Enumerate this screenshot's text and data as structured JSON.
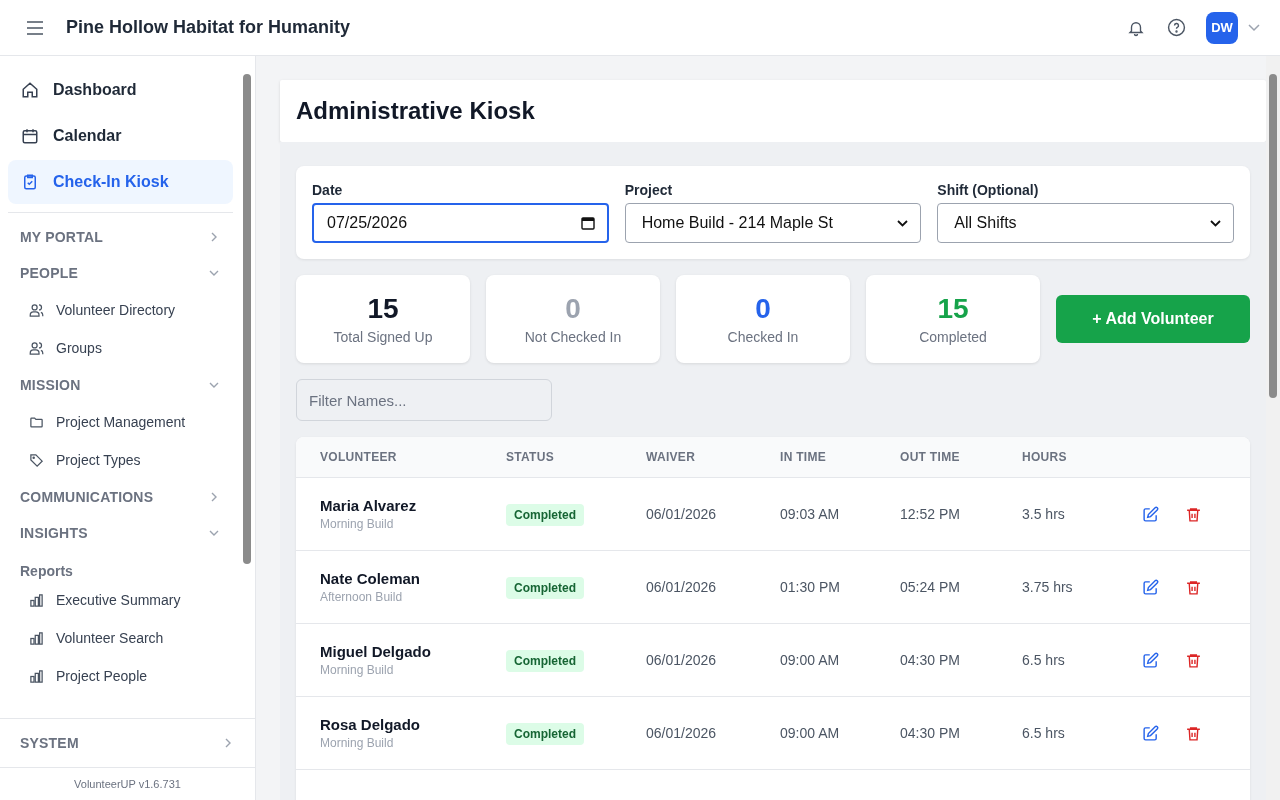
{
  "header": {
    "title": "Pine Hollow Habitat for Humanity",
    "avatar": "DW"
  },
  "sidebar": {
    "top_items": [
      {
        "label": "Dashboard",
        "selected": false
      },
      {
        "label": "Calendar",
        "selected": false
      },
      {
        "label": "Check-In Kiosk",
        "selected": true
      }
    ],
    "sections": [
      {
        "label": "MY PORTAL",
        "expanded": false
      },
      {
        "label": "PEOPLE",
        "expanded": true,
        "children": [
          {
            "label": "Volunteer Directory",
            "kind": "link"
          },
          {
            "label": "Groups",
            "kind": "link"
          }
        ]
      },
      {
        "label": "MISSION",
        "expanded": true,
        "children": [
          {
            "label": "Project Management",
            "kind": "link"
          },
          {
            "label": "Project Types",
            "kind": "link"
          }
        ]
      },
      {
        "label": "COMMUNICATIONS",
        "expanded": false
      },
      {
        "label": "INSIGHTS",
        "expanded": true,
        "children": [
          {
            "label": "Reports",
            "kind": "heading"
          },
          {
            "label": "Executive Summary",
            "kind": "link"
          },
          {
            "label": "Volunteer Search",
            "kind": "link"
          },
          {
            "label": "Project People",
            "kind": "link"
          }
        ]
      }
    ],
    "bottom_section": {
      "label": "SYSTEM",
      "expanded": false
    },
    "version": "VolunteerUP v1.6.731"
  },
  "page": {
    "title": "Administrative Kiosk"
  },
  "filters": [
    {
      "label": "Date",
      "kind": "date",
      "value": "07/25/2026",
      "focused": true
    },
    {
      "label": "Project",
      "kind": "select",
      "value": "Home Build - 214 Maple St",
      "focused": false
    },
    {
      "label": "Shift (Optional)",
      "kind": "select",
      "value": "All Shifts",
      "focused": false
    }
  ],
  "stats": [
    {
      "value": "15",
      "label": "Total Signed Up",
      "color": "#111827"
    },
    {
      "value": "0",
      "label": "Not Checked In",
      "color": "#9ca3af"
    },
    {
      "value": "0",
      "label": "Checked In",
      "color": "#2563eb"
    },
    {
      "value": "15",
      "label": "Completed",
      "color": "#16a34a"
    }
  ],
  "add_button": "+ Add Volunteer",
  "name_filter": {
    "placeholder": "Filter Names..."
  },
  "table": {
    "columns": [
      "VOLUNTEER",
      "STATUS",
      "WAIVER",
      "IN TIME",
      "OUT TIME",
      "HOURS"
    ],
    "rows": [
      {
        "name": "Maria Alvarez",
        "shift": "Morning Build",
        "status": "Completed",
        "waiver": "06/01/2026",
        "in_time": "09:03 AM",
        "out_time": "12:52 PM",
        "hours": "3.5 hrs"
      },
      {
        "name": "Nate Coleman",
        "shift": "Afternoon Build",
        "status": "Completed",
        "waiver": "06/01/2026",
        "in_time": "01:30 PM",
        "out_time": "05:24 PM",
        "hours": "3.75 hrs"
      },
      {
        "name": "Miguel Delgado",
        "shift": "Morning Build",
        "status": "Completed",
        "waiver": "06/01/2026",
        "in_time": "09:00 AM",
        "out_time": "04:30 PM",
        "hours": "6.5 hrs"
      },
      {
        "name": "Rosa Delgado",
        "shift": "Morning Build",
        "status": "Completed",
        "waiver": "06/01/2026",
        "in_time": "09:00 AM",
        "out_time": "04:30 PM",
        "hours": "6.5 hrs"
      }
    ]
  }
}
